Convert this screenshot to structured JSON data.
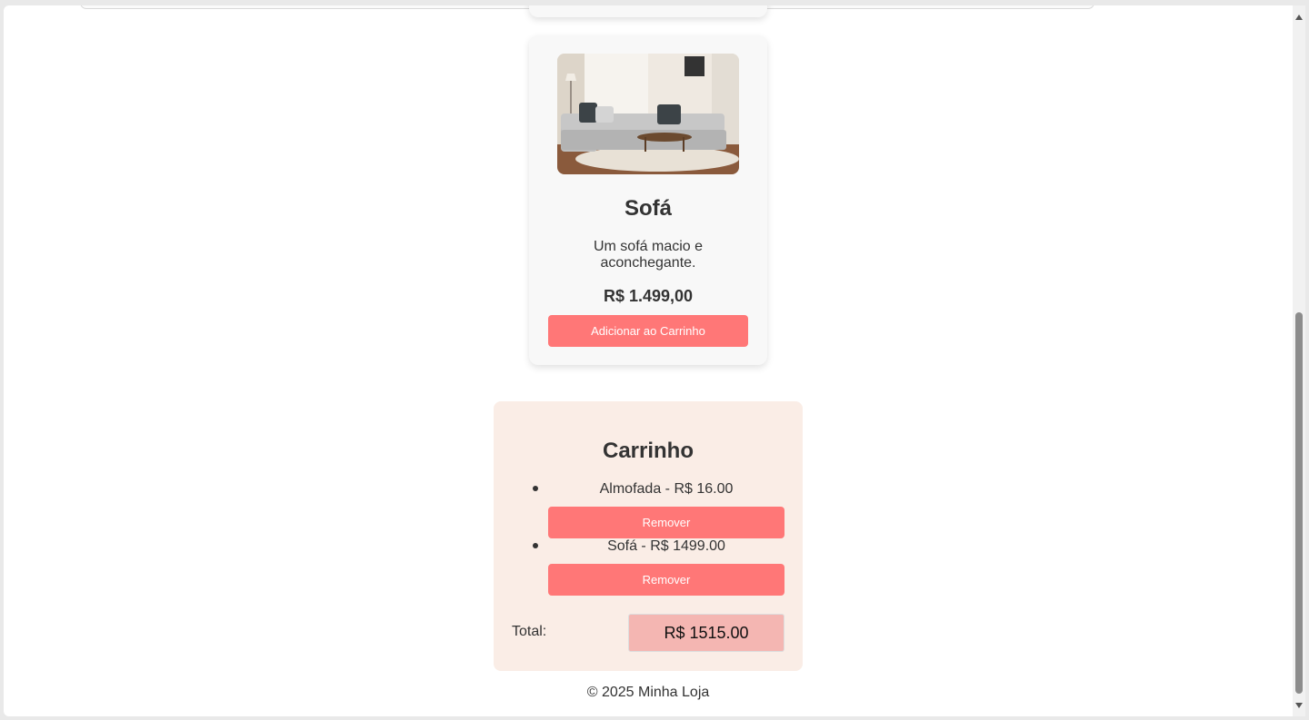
{
  "product": {
    "title": "Sofá",
    "description": "Um sofá macio e aconchegante.",
    "price": "R$ 1.499,00",
    "add_button": "Adicionar ao Carrinho"
  },
  "cart": {
    "title": "Carrinho",
    "items": [
      {
        "label": "Almofada - R$ 16.00",
        "remove": "Remover"
      },
      {
        "label": "Sofá - R$ 1499.00",
        "remove": "Remover"
      }
    ],
    "total_label": "Total:",
    "total_value": "R$ 1515.00"
  },
  "footer": {
    "text": "© 2025 Minha Loja"
  },
  "colors": {
    "accent": "#ff7777",
    "cart_bg": "#faede6",
    "total_bg": "#f4b6b2"
  },
  "icons": {
    "scroll_up": "scroll-up-arrow-icon",
    "scroll_down": "scroll-down-arrow-icon"
  }
}
